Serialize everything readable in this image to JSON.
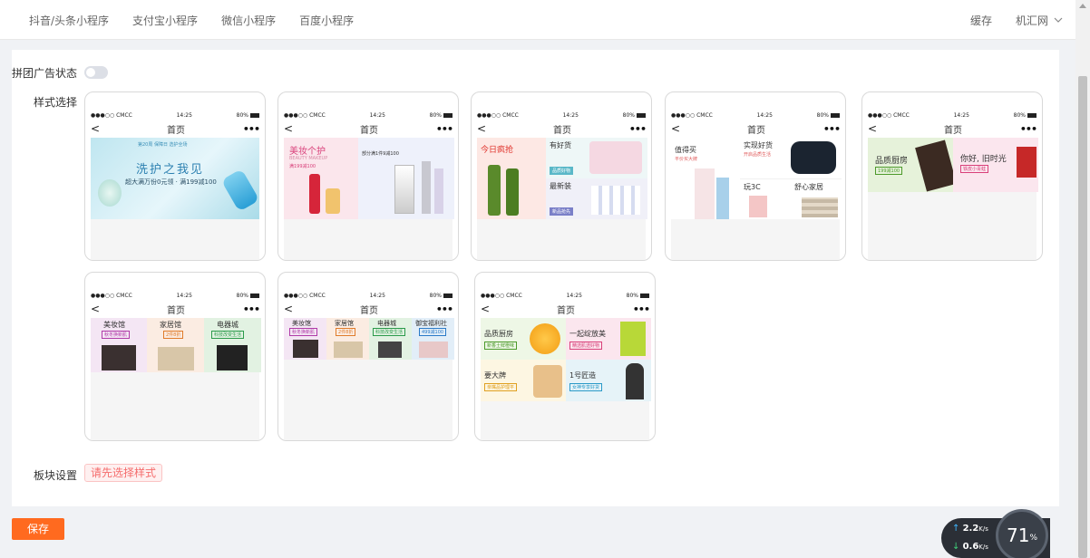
{
  "topbar": {
    "tabs": [
      "抖音/头条小程序",
      "支付宝小程序",
      "微信小程序",
      "百度小程序"
    ],
    "cache": "缓存",
    "user": "机汇网"
  },
  "form": {
    "ad_status_label": "拼团广告状态",
    "style_label": "样式选择",
    "block_label": "板块设置",
    "block_hint": "请先选择样式",
    "save": "保存"
  },
  "phone": {
    "carrier": "●●●○○ CMCC",
    "time": "14:25",
    "battery": "80%",
    "title": "首页",
    "back": "<",
    "more": "•••"
  },
  "styles": [
    {
      "banner_title": "洗护之我见",
      "banner_sub": "超大满万份0元领 · 满199减100",
      "banner_top": "第20周 保障日 选护全场"
    },
    {
      "t1": "美妆个护",
      "t2": "BEAUTY MAKEUP",
      "t3": "满199减100",
      "t4": "部分满1件9减100"
    },
    {
      "t1": "今日疯抢",
      "t2": "有好货",
      "t3": "最新装",
      "t4": "品质好物",
      "t5": "新品抢先"
    },
    {
      "t1": "值得买",
      "t2": "平价买大牌",
      "t3": "实现好货",
      "t4": "开启品质生活",
      "t5": "玩3C",
      "t6": "舒心家居"
    },
    {
      "t1": "品质厨房",
      "t2": "199减100",
      "t3": "你好, 旧时光",
      "t4": "铁皮小青蛙"
    },
    {
      "t1": "美妆馆",
      "t2": "秋冬换新肌",
      "t3": "家居馆",
      "t4": "2件8折",
      "t5": "电器城",
      "t6": "科技改变生活"
    },
    {
      "t1": "美妆馆",
      "t2": "秋冬换新肌",
      "t3": "家居馆",
      "t4": "2件8折",
      "t5": "电器城",
      "t6": "科技改变生活",
      "t7": "御宝福利社",
      "t8": "499减100"
    },
    {
      "t1": "品质厨房",
      "t2": "新香土鲜橙味",
      "t3": "一起绽放美",
      "t4": "精选肌透好物",
      "t5": "要大牌",
      "t6": "亲嘴品护理平",
      "t7": "1号匠造",
      "t8": "女神专享好货"
    }
  ],
  "net": {
    "up": "2.2",
    "down": "0.6",
    "unit": "K/s",
    "percent": "71",
    "percent_sign": "%"
  }
}
